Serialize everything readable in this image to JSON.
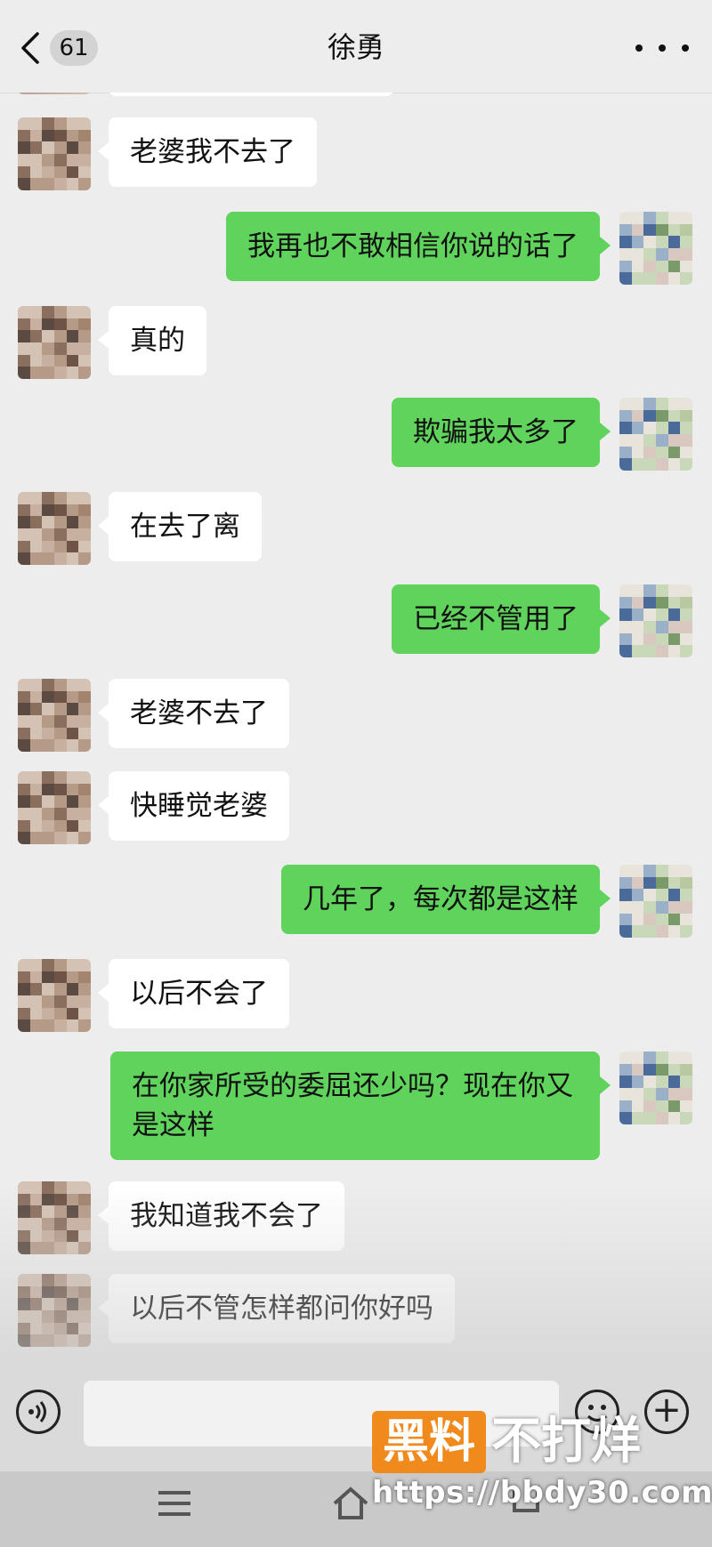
{
  "header": {
    "back_count": "61",
    "title": "徐勇",
    "more_icon": "more-dots-icon"
  },
  "colors": {
    "background": "#ededed",
    "incoming_bubble": "#ffffff",
    "outgoing_bubble": "#5fd35c",
    "watermark_orange": "#f08a1c"
  },
  "messages": [
    {
      "side": "in",
      "text": "老婆我不去了"
    },
    {
      "side": "out",
      "text": "我再也不敢相信你说的话了"
    },
    {
      "side": "in",
      "text": "真的"
    },
    {
      "side": "out",
      "text": "欺骗我太多了"
    },
    {
      "side": "in",
      "text": "在去了离"
    },
    {
      "side": "out",
      "text": "已经不管用了"
    },
    {
      "side": "in",
      "text": "老婆不去了"
    },
    {
      "side": "in",
      "text": "快睡觉老婆"
    },
    {
      "side": "out",
      "text": "几年了，每次都是这样"
    },
    {
      "side": "in",
      "text": "以后不会了"
    },
    {
      "side": "out",
      "text": "在你家所受的委屈还少吗？现在你又是这样"
    },
    {
      "side": "in",
      "text": "我知道我不会了"
    },
    {
      "side": "in",
      "text": "以后不管怎样都问你好吗"
    }
  ],
  "input_bar": {
    "voice_icon": "voice-icon",
    "emoji_icon": "emoji-icon",
    "plus_icon": "plus-icon"
  },
  "watermark": {
    "box_text": "黑料",
    "text": "不打烊",
    "url": "https://bbdy30.com"
  }
}
